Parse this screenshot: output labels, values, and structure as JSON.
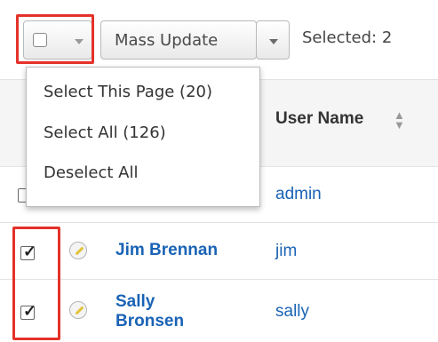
{
  "toolbar": {
    "mass_update_label": "Mass Update",
    "selected_label": "Selected: 2"
  },
  "dropdown": {
    "items": [
      "Select This Page (20)",
      "Select All (126)",
      "Deselect All"
    ]
  },
  "table": {
    "column_headers": {
      "user_name": "User Name"
    },
    "rows": [
      {
        "full_name": "",
        "user_name": "admin",
        "checked": false
      },
      {
        "full_name": "Jim Brennan",
        "user_name": "jim",
        "checked": true
      },
      {
        "full_name": "Sally Bronsen",
        "user_name": "sally",
        "checked": true
      }
    ]
  },
  "colors": {
    "highlight": "#e4322a",
    "link": "#1a63b5"
  }
}
